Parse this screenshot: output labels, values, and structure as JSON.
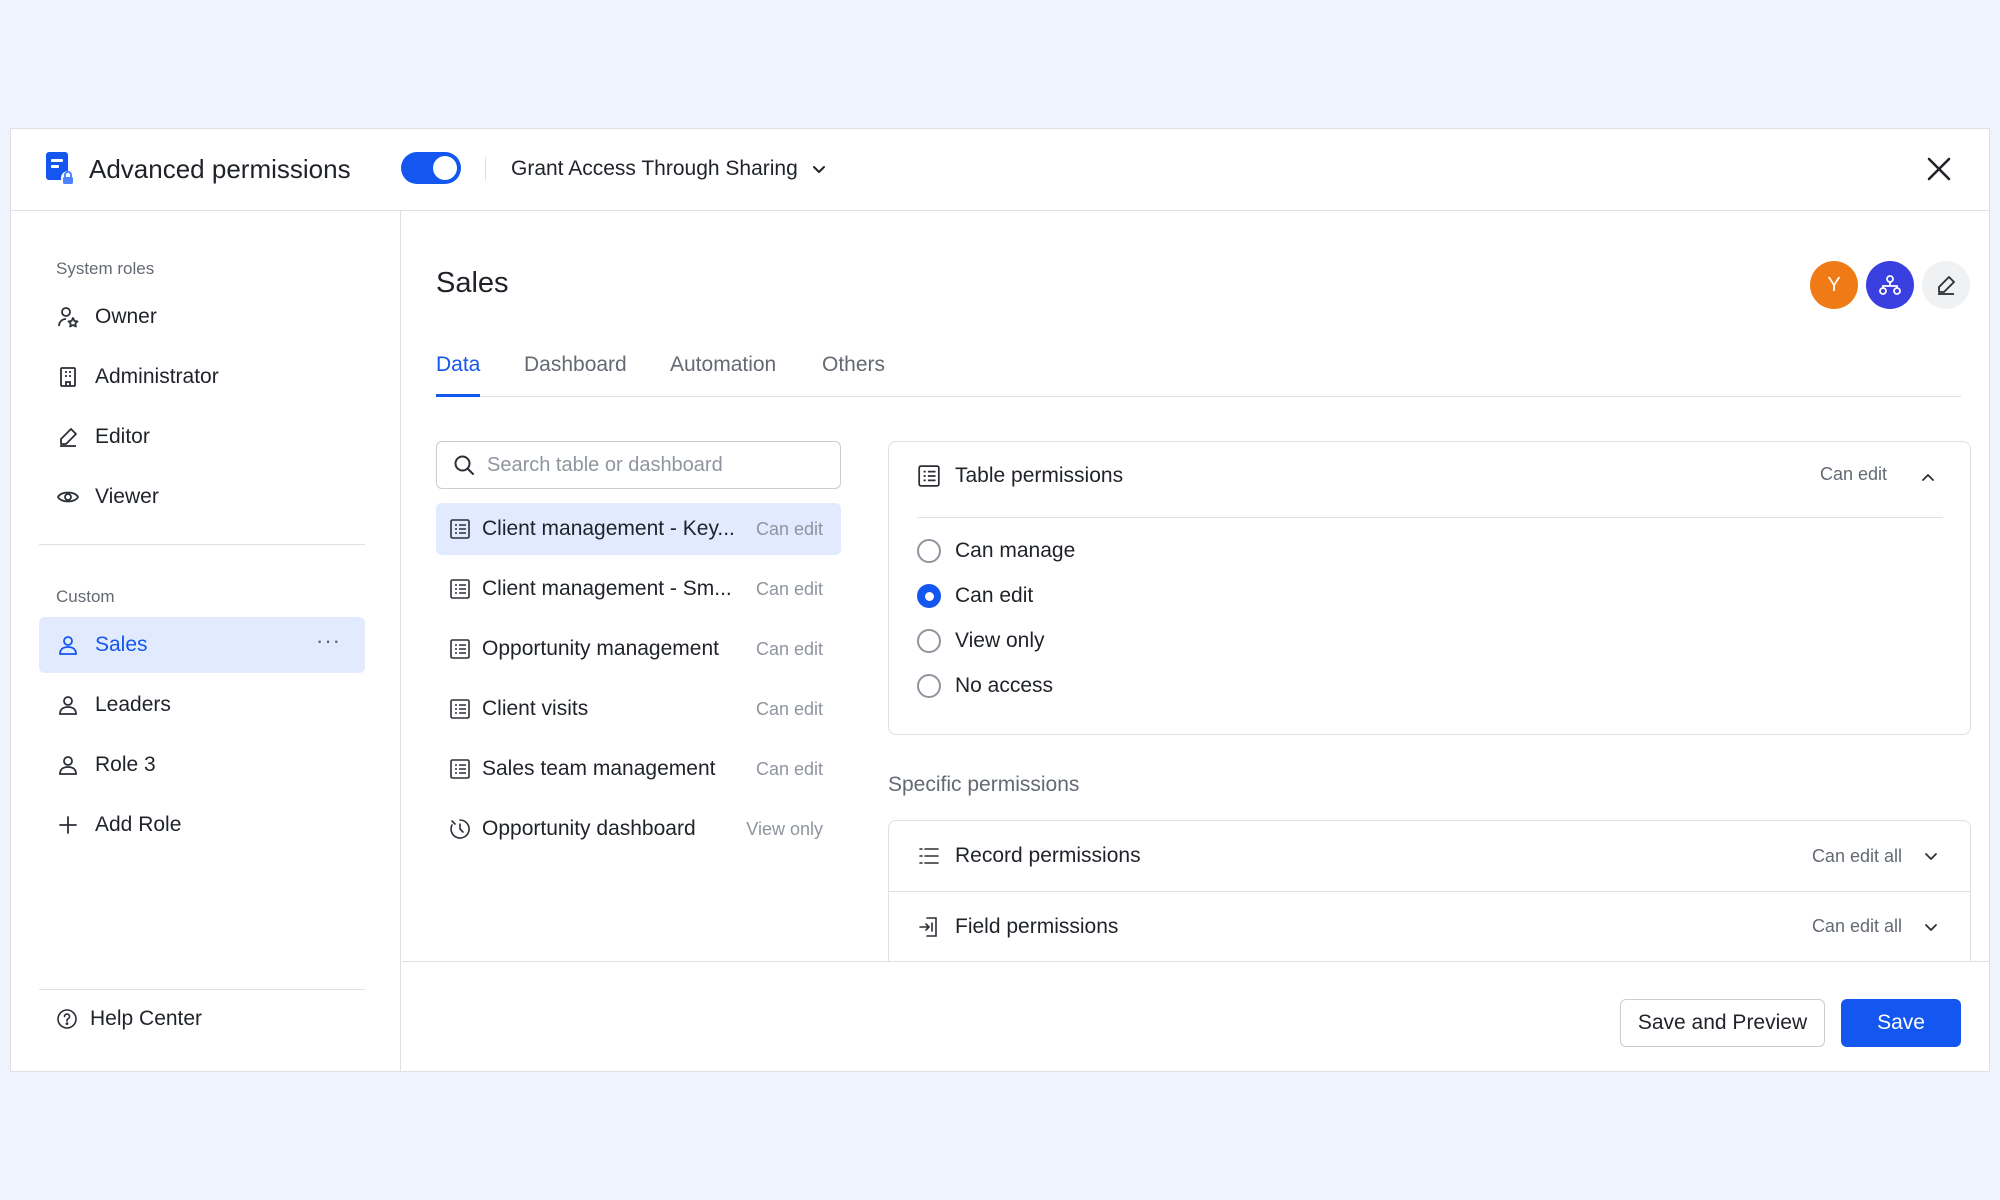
{
  "header": {
    "title": "Advanced permissions",
    "toggle_on": true,
    "grant_label": "Grant Access Through Sharing"
  },
  "sidebar": {
    "system_roles_label": "System roles",
    "system_roles": [
      {
        "label": "Owner",
        "icon": "owner-icon"
      },
      {
        "label": "Administrator",
        "icon": "building-icon"
      },
      {
        "label": "Editor",
        "icon": "pencil-icon"
      },
      {
        "label": "Viewer",
        "icon": "eye-icon"
      }
    ],
    "custom_label": "Custom",
    "custom_roles": [
      {
        "label": "Sales",
        "icon": "user-icon",
        "active": true
      },
      {
        "label": "Leaders",
        "icon": "user-icon"
      },
      {
        "label": "Role 3",
        "icon": "user-icon"
      }
    ],
    "add_role_label": "Add Role",
    "help_label": "Help Center"
  },
  "main": {
    "title": "Sales",
    "avatars": [
      {
        "text": "Y",
        "color": "#f07b16"
      },
      {
        "icon": "org-chart-icon",
        "color": "#3a3fe0"
      },
      {
        "icon": "edit-icon",
        "color": "#f0f1f3"
      }
    ],
    "tabs": [
      {
        "label": "Data",
        "active": true
      },
      {
        "label": "Dashboard"
      },
      {
        "label": "Automation"
      },
      {
        "label": "Others"
      }
    ],
    "search": {
      "placeholder": "Search table or dashboard",
      "value": ""
    },
    "tables": [
      {
        "name": "Client management - Key...",
        "perm": "Can edit",
        "icon": "table-icon",
        "active": true
      },
      {
        "name": "Client management - Sm...",
        "perm": "Can edit",
        "icon": "table-icon"
      },
      {
        "name": "Opportunity management",
        "perm": "Can edit",
        "icon": "table-icon"
      },
      {
        "name": "Client visits",
        "perm": "Can edit",
        "icon": "table-icon"
      },
      {
        "name": "Sales team management",
        "perm": "Can edit",
        "icon": "table-icon"
      },
      {
        "name": "Opportunity dashboard",
        "perm": "View only",
        "icon": "dashboard-icon"
      }
    ],
    "table_permissions": {
      "title": "Table permissions",
      "value": "Can edit",
      "options": [
        "Can manage",
        "Can edit",
        "View only",
        "No access"
      ],
      "selected": "Can edit"
    },
    "specific_title": "Specific permissions",
    "specific": [
      {
        "title": "Record permissions",
        "value": "Can edit all",
        "icon": "list-icon"
      },
      {
        "title": "Field permissions",
        "value": "Can edit all",
        "icon": "field-icon"
      }
    ]
  },
  "footer": {
    "save_preview_label": "Save and Preview",
    "save_label": "Save"
  },
  "colors": {
    "accent": "#1456f0",
    "active_bg": "#e1eaff",
    "page_bg": "#eff3fd"
  }
}
